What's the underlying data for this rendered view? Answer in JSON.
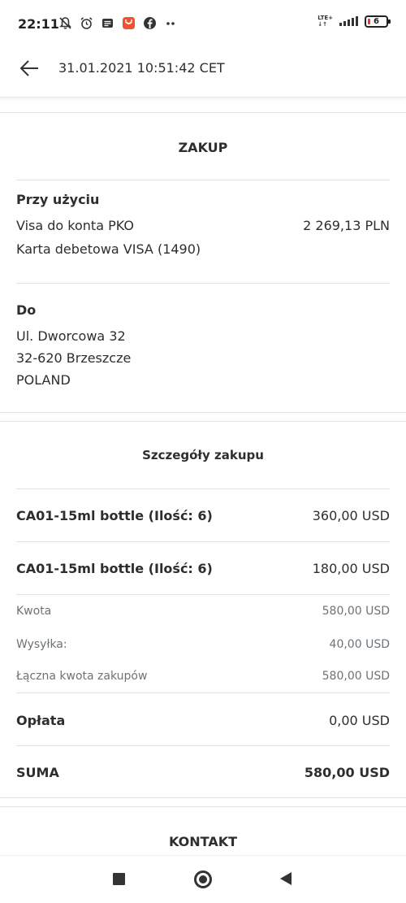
{
  "status_bar": {
    "time": "22:11",
    "network": "LTE+",
    "battery": "6"
  },
  "header": {
    "title": "31.01.2021 10:51:42 CET"
  },
  "purchase": {
    "section_title": "ZAKUP",
    "used_label": "Przy użyciu",
    "account_name": "Visa do konta PKO",
    "account_amount": "2 269,13 PLN",
    "card": "Karta debetowa VISA (1490)",
    "to_label": "Do",
    "address_line1": "Ul. Dworcowa 32",
    "address_line2": "32-620 Brzeszcze",
    "address_line3": "POLAND"
  },
  "details": {
    "section_title": "Szczegóły zakupu",
    "items": [
      {
        "name": "CA01-15ml bottle (Ilość: 6)",
        "amount": "360,00 USD"
      },
      {
        "name": "CA01-15ml bottle (Ilość: 6)",
        "amount": "180,00 USD"
      }
    ],
    "kwota_label": "Kwota",
    "kwota_value": "580,00 USD",
    "shipping_label": "Wysyłka:",
    "shipping_value": "40,00 USD",
    "total_purchases_label": "Łączna kwota zakupów",
    "total_purchases_value": "580,00 USD",
    "fee_label": "Opłata",
    "fee_value": "0,00 USD",
    "sum_label": "SUMA",
    "sum_value": "580,00 USD"
  },
  "contact": {
    "section_title": "KONTAKT"
  }
}
